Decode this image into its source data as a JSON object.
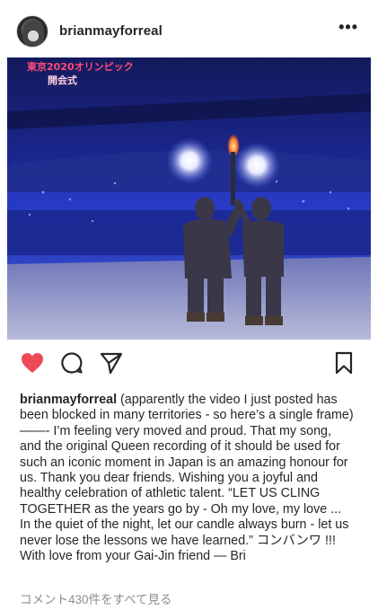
{
  "post": {
    "username": "brianmayforreal",
    "more_label": "•••",
    "photo": {
      "overlay_line1": "東京2020オリンピック",
      "overlay_line2": "開会式"
    },
    "actions": {
      "like": "heart-icon",
      "comment": "comment-icon",
      "share": "paper-plane-icon",
      "save": "bookmark-icon",
      "like_color": "#ed4956"
    },
    "caption_author": "brianmayforreal",
    "caption_text": " (apparently the video I just posted has been blocked in many territories - so here’s a single frame) ——- I’m feeling very moved and proud. That my song, and the original Queen recording of it should be used for such an iconic moment in Japan is an amazing honour for us. Thank you dear friends. Wishing you a joyful and healthy celebration of athletic talent. “LET US CLING TOGETHER as the years go by - Oh my love, my love ... In the quiet of the night, let our candle always burn - let us never lose the lessons we have learned.” コンバンワ !!! With love from your Gai-Jin friend — Bri",
    "view_comments": "コメント430件をすべて見る"
  }
}
